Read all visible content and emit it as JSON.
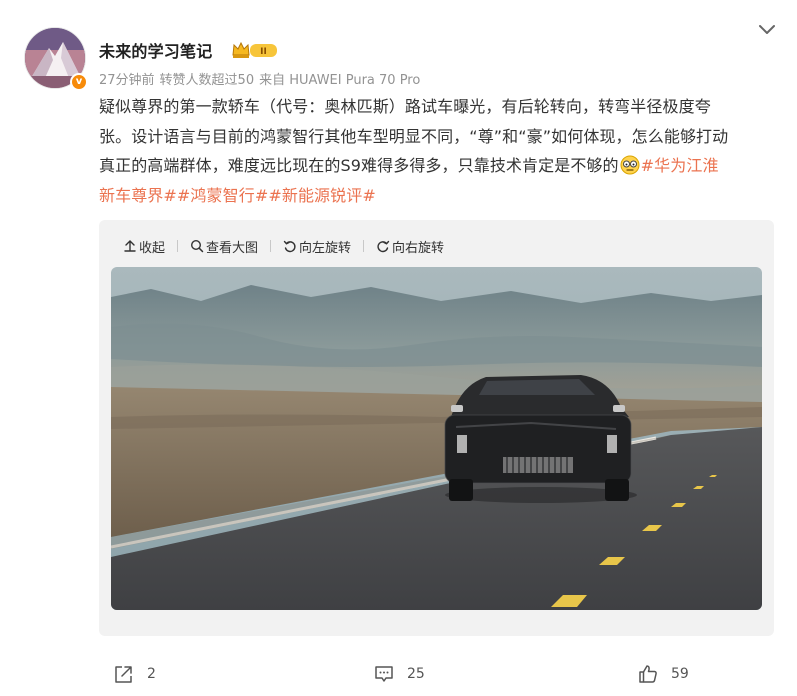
{
  "post": {
    "username": "未来的学习笔记",
    "rank_badge": "II",
    "avatar_badge": "v",
    "meta": {
      "time": "27分钟前",
      "reposts_note": "转赞人数超过50",
      "source": "来自 HUAWEI Pura 70 Pro"
    },
    "text_lines": [
      "疑似尊界的第一款轿车（代号：奥林匹斯）路试车曝光，有后轮转向，转弯半径极度夸",
      "张。设计语言与目前的鸿蒙智行其他车型明显不同，“尊”和“豪”如何体现，怎么能够打动",
      "真正的高端群体，难度远比现在的S9难得多得多，只靠技术肯定是不够的"
    ],
    "hashtag_1a": "#华为江淮",
    "hashtag_1b": "新车尊界#",
    "hashtag_2": "#鸿蒙智行#",
    "hashtag_3": "#新能源锐评#"
  },
  "media_toolbar": {
    "collapse": "收起",
    "view_large": "查看大图",
    "rotate_left": "向左旋转",
    "rotate_right": "向右旋转"
  },
  "actions": {
    "share_count": "2",
    "comment_count": "25",
    "like_count": "59"
  },
  "colors": {
    "hashtag": "#eb7350",
    "meta_gray": "#939393",
    "card_bg": "#f2f2f2",
    "badge_orange": "#f78b0a"
  },
  "icons": [
    "v-badge-icon",
    "crown-rank-icon",
    "chevron-down-icon",
    "collapse-arrow-icon",
    "magnifier-icon",
    "rotate-left-icon",
    "rotate-right-icon",
    "share-icon",
    "comment-icon",
    "like-icon",
    "speechless-face-emoji"
  ]
}
